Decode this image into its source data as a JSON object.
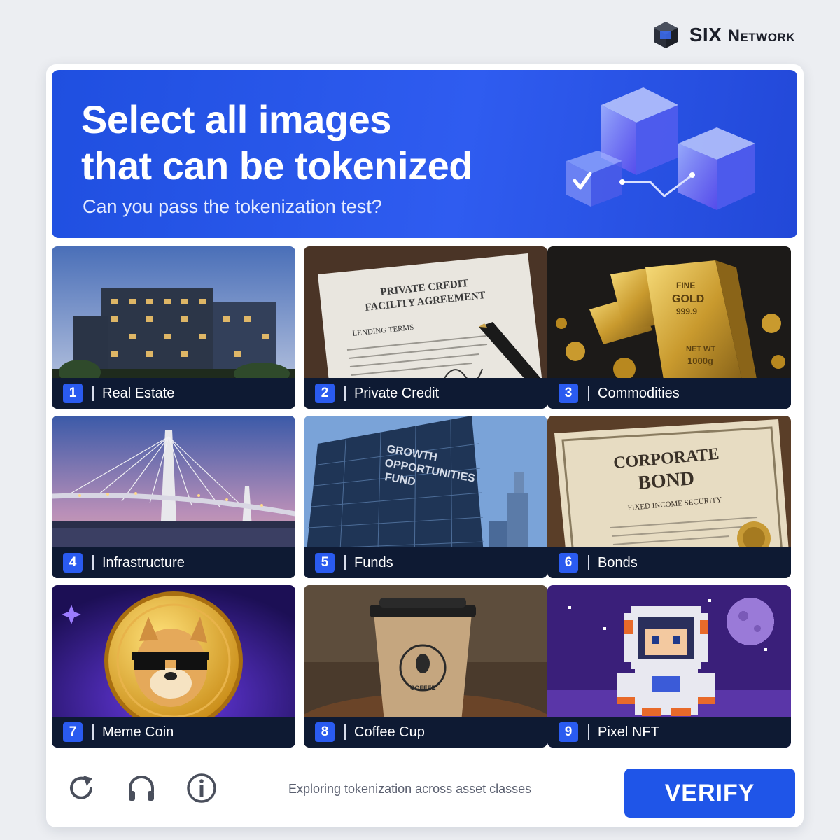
{
  "brand": {
    "name_lead": "SIX ",
    "name_tail": "Network",
    "logo_icon": "six-network-cube-logo"
  },
  "banner": {
    "title": "Select all images\nthat can be tokenized",
    "subtitle": "Can you pass the tokenization test?",
    "art_icon": "glass-cubes-checkmark-illustration"
  },
  "tiles": [
    {
      "number": "1",
      "label": "Real Estate"
    },
    {
      "number": "2",
      "label": "Private Credit",
      "doc_title_1": "PRIVATE CREDIT",
      "doc_title_2": "FACILITY AGREEMENT",
      "doc_sub": "LENDING TERMS"
    },
    {
      "number": "3",
      "label": "Commodities",
      "bar_text_1": "FINE",
      "bar_text_2": "GOLD",
      "bar_text_3": "999.9",
      "bar_text_4": "NET WT",
      "bar_text_5": "1000g"
    },
    {
      "number": "4",
      "label": "Infrastructure"
    },
    {
      "number": "5",
      "label": "Funds",
      "sign_1": "GROWTH",
      "sign_2": "OPPORTUNITIES",
      "sign_3": "FUND"
    },
    {
      "number": "6",
      "label": "Bonds",
      "cert_1": "CORPORATE",
      "cert_2": "BOND",
      "cert_3": "FIXED INCOME SECURITY"
    },
    {
      "number": "7",
      "label": "Meme Coin"
    },
    {
      "number": "8",
      "label": "Coffee Cup",
      "cup_text": "COFFEE"
    },
    {
      "number": "9",
      "label": "Pixel NFT"
    }
  ],
  "footer": {
    "reload_icon": "reload-icon",
    "audio_icon": "headphones-icon",
    "info_icon": "info-icon",
    "note": "Exploring tokenization across asset classes",
    "verify_label": "VERIFY"
  },
  "colors": {
    "accent": "#1f55e8",
    "banner": "#2f5cf0",
    "caption_bg": "#0e1a33",
    "num_badge": "#2a5bf0"
  }
}
